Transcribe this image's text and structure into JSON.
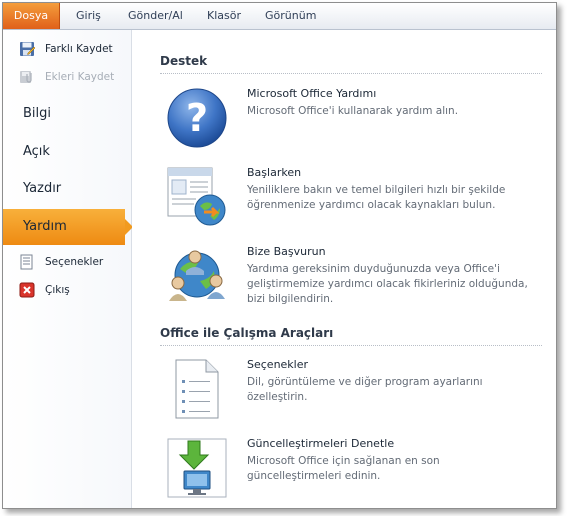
{
  "tabs": [
    {
      "label": "Dosya"
    },
    {
      "label": "Giriş"
    },
    {
      "label": "Gönder/Al"
    },
    {
      "label": "Klasör"
    },
    {
      "label": "Görünüm"
    }
  ],
  "nav": {
    "commands": [
      {
        "label": "Farklı Kaydet",
        "icon": "save-as-icon"
      },
      {
        "label": "Ekleri Kaydet",
        "icon": "save-attachments-icon",
        "disabled": true
      }
    ],
    "tabs": [
      {
        "label": "Bilgi"
      },
      {
        "label": "Açık"
      },
      {
        "label": "Yazdır"
      },
      {
        "label": "Yardım",
        "selected": true
      }
    ],
    "bottom_commands": [
      {
        "label": "Seçenekler",
        "icon": "options-icon"
      },
      {
        "label": "Çıkış",
        "icon": "exit-icon"
      }
    ]
  },
  "support": {
    "title": "Destek",
    "items": [
      {
        "title": "Microsoft Office Yardımı",
        "desc": "Microsoft Office'i kullanarak yardım alın.",
        "icon": "help-icon"
      },
      {
        "title": "Başlarken",
        "desc": "Yeniliklere bakın ve temel bilgileri hızlı bir şekilde öğrenmenize yardımcı olacak kaynakları bulun.",
        "icon": "getting-started-icon"
      },
      {
        "title": "Bize Başvurun",
        "desc": "Yardıma gereksinim duyduğunuzda veya Office'i geliştirmemize yardımcı olacak fikirleriniz olduğunda, bizi bilgilendirin.",
        "icon": "contact-us-icon"
      }
    ]
  },
  "tools": {
    "title": "Office ile Çalışma Araçları",
    "items": [
      {
        "title": "Seçenekler",
        "desc": "Dil, görüntüleme ve diğer program ayarlarını özelleştirin.",
        "icon": "options-document-icon"
      },
      {
        "title": "Güncelleştirmeleri Denetle",
        "desc": "Microsoft Office için sağlanan en son güncelleştirmeleri edinin.",
        "icon": "check-updates-icon"
      }
    ]
  },
  "colors": {
    "file_tab": "#e46c1f",
    "selected_nav": "#f39c1f",
    "text": "#1b2736",
    "desc_text": "#636b76"
  }
}
